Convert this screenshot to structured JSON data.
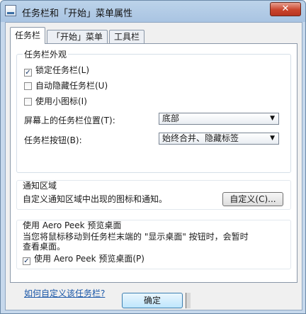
{
  "window": {
    "title": "任务栏和「开始」菜单属性",
    "close_label": "✕"
  },
  "tabs": [
    {
      "label": "任务栏",
      "active": true
    },
    {
      "label": "「开始」菜单",
      "active": false
    },
    {
      "label": "工具栏",
      "active": false
    }
  ],
  "appearance": {
    "title": "任务栏外观",
    "lock_label": "锁定任务栏(L)",
    "autohide_label": "自动隐藏任务栏(U)",
    "small_icons_label": "使用小图标(I)",
    "location_label": "屏幕上的任务栏位置(T):",
    "location_value": "底部",
    "buttons_label": "任务栏按钮(B):",
    "buttons_value": "始终合并、隐藏标签"
  },
  "notification": {
    "title": "通知区域",
    "description": "自定义通知区域中出现的图标和通知。",
    "customize_label": "自定义(C)..."
  },
  "aero_peek": {
    "title": "使用 Aero Peek 预览桌面",
    "description_line1": "当您将鼠标移动到任务栏末端的 \"显示桌面\" 按钮时，会暂时",
    "description_line2": "查看桌面。",
    "checkbox_label": "使用 Aero Peek 预览桌面(P)"
  },
  "help_link": "如何自定义该任务栏?",
  "ok_label": "确定",
  "check_mark": "✓",
  "arrow_glyph": "▼",
  "colors": {
    "title_bar": "#bcd3ea",
    "link": "#1a57a8",
    "close_button": "#c9442c"
  }
}
